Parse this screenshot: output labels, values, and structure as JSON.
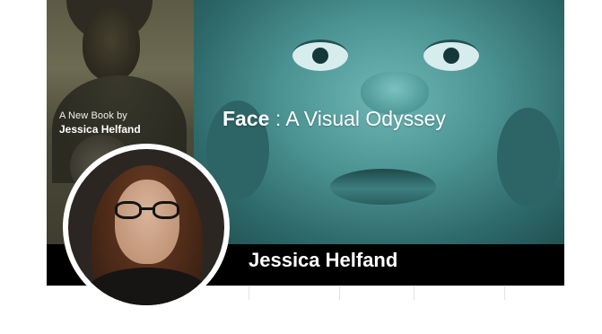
{
  "profile": {
    "name": "Jessica Helfand"
  },
  "cover": {
    "book_subtitle": "A New Book by",
    "book_author": "Jessica Helfand",
    "title_bold": "Face",
    "title_rest": " : A Visual Odyssey"
  },
  "colors": {
    "name_bar": "#000000",
    "cover_teal": "#4c9494",
    "cover_left_sepia": "#5c5a44"
  }
}
